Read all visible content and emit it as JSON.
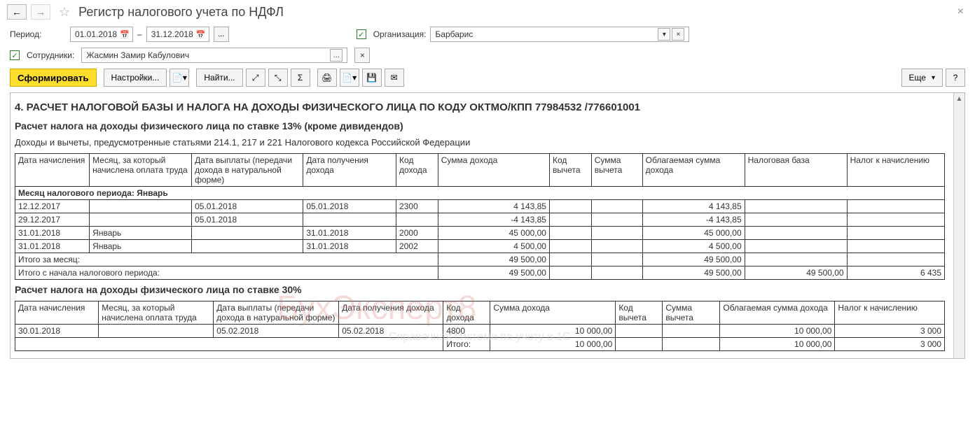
{
  "header": {
    "title": "Регистр налогового учета по НДФЛ"
  },
  "filters": {
    "period_label": "Период:",
    "date_from": "01.01.2018",
    "date_to": "31.12.2018",
    "dash": "–",
    "dots": "...",
    "org_label": "Организация:",
    "org_value": "Барбарис",
    "employees_label": "Сотрудники:",
    "employee_value": "Жасмин Замир Кабулович"
  },
  "toolbar": {
    "generate": "Сформировать",
    "settings": "Настройки...",
    "find": "Найти...",
    "more": "Еще",
    "help": "?"
  },
  "report": {
    "section_title": "4. РАСЧЕТ НАЛОГОВОЙ БАЗЫ И НАЛОГА НА ДОХОДЫ ФИЗИЧЕСКОГО ЛИЦА ПО КОДУ ОКТМО/КПП 77984532   /776601001",
    "sub13": "Расчет налога на доходы физического лица по ставке 13% (кроме дивидендов)",
    "articles": "Доходы и вычеты, предусмотренные статьями 214.1, 217 и 221 Налогового кодекса Российской Федерации",
    "sub30": "Расчет налога на доходы физического лица по ставке 30%",
    "headers": {
      "accrual_date": "Дата начисления",
      "month": "Месяц, за который начислена оплата труда",
      "pay_date": "Дата выплаты (передачи дохода в натуральной форме)",
      "income_date": "Дата получения дохода",
      "income_code": "Код дохода",
      "income_sum": "Сумма дохода",
      "deduct_code": "Код вычета",
      "deduct_sum": "Сумма вычета",
      "taxable": "Облагаемая сумма дохода",
      "tax_base": "Налоговая база",
      "tax_due": "Налог к начислению"
    },
    "month_group": "Месяц налогового периода: Январь",
    "rows13": [
      {
        "accrual": "12.12.2017",
        "month": "",
        "pay": "05.01.2018",
        "recv": "05.01.2018",
        "code": "2300",
        "sum": "4 143,85",
        "vcode": "",
        "vsum": "",
        "taxable": "4 143,85",
        "base": "",
        "due": ""
      },
      {
        "accrual": "29.12.2017",
        "month": "",
        "pay": "05.01.2018",
        "recv": "",
        "code": "",
        "sum": "-4 143,85",
        "vcode": "",
        "vsum": "",
        "taxable": "-4 143,85",
        "base": "",
        "due": ""
      },
      {
        "accrual": "31.01.2018",
        "month": "Январь",
        "pay": "",
        "recv": "31.01.2018",
        "code": "2000",
        "sum": "45 000,00",
        "vcode": "",
        "vsum": "",
        "taxable": "45 000,00",
        "base": "",
        "due": ""
      },
      {
        "accrual": "31.01.2018",
        "month": "Январь",
        "pay": "",
        "recv": "31.01.2018",
        "code": "2002",
        "sum": "4 500,00",
        "vcode": "",
        "vsum": "",
        "taxable": "4 500,00",
        "base": "",
        "due": ""
      }
    ],
    "total_month_label": "Итого за месяц:",
    "total_month_sum": "49 500,00",
    "total_month_tax": "49 500,00",
    "total_period_label": "Итого с начала налогового периода:",
    "total_period_sum": "49 500,00",
    "total_period_tax": "49 500,00",
    "total_period_base": "49 500,00",
    "total_period_due": "6 435",
    "rows30": [
      {
        "accrual": "30.01.2018",
        "month": "",
        "pay": "05.02.2018",
        "recv": "05.02.2018",
        "code": "4800",
        "sum": "10 000,00",
        "vcode": "",
        "vsum": "",
        "taxable": "10 000,00",
        "base": "",
        "due": "3 000"
      }
    ],
    "total30_label": "Итого:",
    "total30_sum": "10 000,00",
    "total30_tax": "10 000,00",
    "total30_due": "3 000"
  },
  "watermark": {
    "main": "БухЭксперт8",
    "sub": "Справочная система по учету в 1С"
  }
}
